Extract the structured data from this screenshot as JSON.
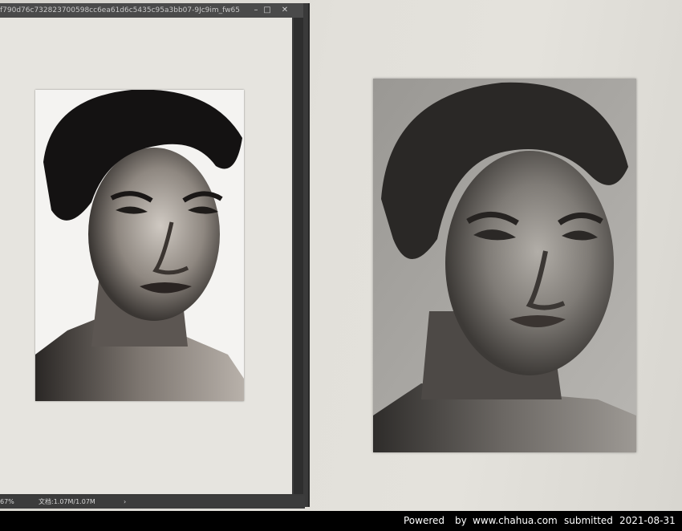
{
  "window": {
    "title": "f790d76c732823700598cc6ea61d6c5435c95a3bb07-9Jc9im_fw65...",
    "minimize_glyph": "–",
    "maximize_glyph": "□",
    "close_glyph": "✕"
  },
  "statusbar": {
    "zoom": "67%",
    "doc_size": "文档:1.07M/1.07M",
    "arrow": "›"
  },
  "caption": {
    "powered": "Powered",
    "by": "by",
    "site": "www.chahua.com",
    "submitted": "submitted",
    "date": "2021-08-31"
  },
  "colors": {
    "window_frame": "#3a3a3a",
    "canvas": "#e6e4df",
    "caption_bg": "#000000"
  }
}
